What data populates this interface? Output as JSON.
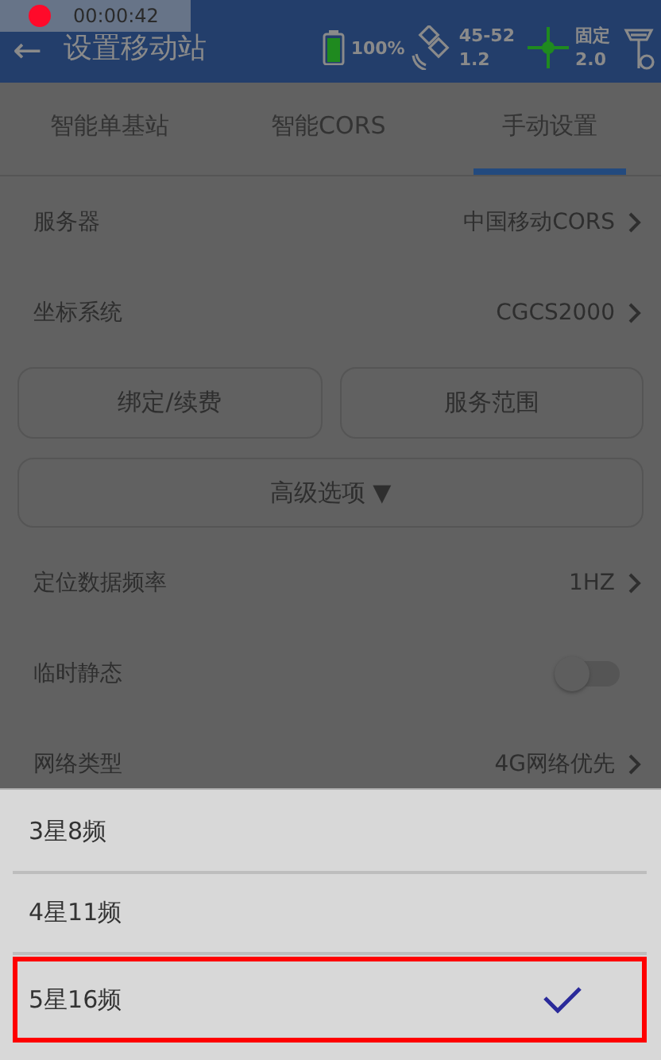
{
  "recording": {
    "time": "00:00:42"
  },
  "header": {
    "back": "←",
    "title": "设置移动站",
    "battery": "100%",
    "satellites": {
      "count": "45-52",
      "pdop": "1.2"
    },
    "solution": {
      "status": "固定",
      "age": "2.0"
    }
  },
  "tabs": [
    {
      "label": "智能单基站",
      "selected": false
    },
    {
      "label": "智能CORS",
      "selected": false
    },
    {
      "label": "手动设置",
      "selected": true
    }
  ],
  "rows": [
    {
      "kind": "link",
      "label": "服务器",
      "value": "中国移动CORS"
    },
    {
      "kind": "link",
      "label": "坐标系统",
      "value": "CGCS2000"
    },
    {
      "kind": "buttons",
      "buttons": [
        "绑定/续费",
        "服务范围"
      ]
    },
    {
      "kind": "expander",
      "label": "高级选项",
      "caret": "▼"
    },
    {
      "kind": "link",
      "label": "定位数据频率",
      "value": "1HZ"
    },
    {
      "kind": "toggle",
      "label": "临时静态",
      "on": false
    },
    {
      "kind": "link",
      "label": "网络类型",
      "value": "4G网络优先"
    }
  ],
  "sheet": {
    "options": [
      {
        "label": "3星8频",
        "selected": false,
        "highlighted": false
      },
      {
        "label": "4星11频",
        "selected": false,
        "highlighted": false
      },
      {
        "label": "5星16频",
        "selected": true,
        "highlighted": true
      }
    ]
  }
}
